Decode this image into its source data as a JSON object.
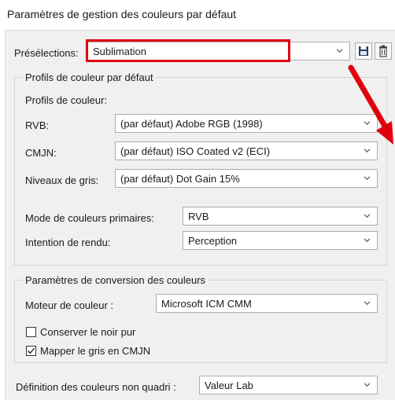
{
  "dialog": {
    "title": "Paramètres de gestion des couleurs par défaut"
  },
  "presets": {
    "label": "Présélections:",
    "value": "Sublimation",
    "save_icon": "save-icon",
    "delete_icon": "trash-icon"
  },
  "default_profiles": {
    "group_title": "Profils de couleur par défaut",
    "subheading": "Profils de couleur:",
    "rgb": {
      "label": "RVB:",
      "value": "(par défaut) Adobe RGB (1998)"
    },
    "cmyk": {
      "label": "CMJN:",
      "value": "(par défaut) ISO Coated v2 (ECI)"
    },
    "gray": {
      "label": "Niveaux de gris:",
      "value": "(par défaut) Dot Gain 15%"
    },
    "primary_mode": {
      "label": "Mode de couleurs primaires:",
      "value": "RVB"
    },
    "rendering_intent": {
      "label": "Intention de rendu:",
      "value": "Perception"
    }
  },
  "conversion": {
    "group_title": "Paramètres de conversion des couleurs",
    "engine": {
      "label": "Moteur de couleur :",
      "value": "Microsoft ICM CMM"
    },
    "keep_pure_black": {
      "label": "Conserver le noir pur",
      "checked": false
    },
    "map_gray_cmyk": {
      "label": "Mapper le gris en CMJN",
      "checked": true
    }
  },
  "spot_colors": {
    "label": "Définition des couleurs non quadri :",
    "value": "Valeur Lab"
  },
  "annotations": {
    "highlight_color": "#e2000f",
    "arrow_color": "#e2000f"
  }
}
